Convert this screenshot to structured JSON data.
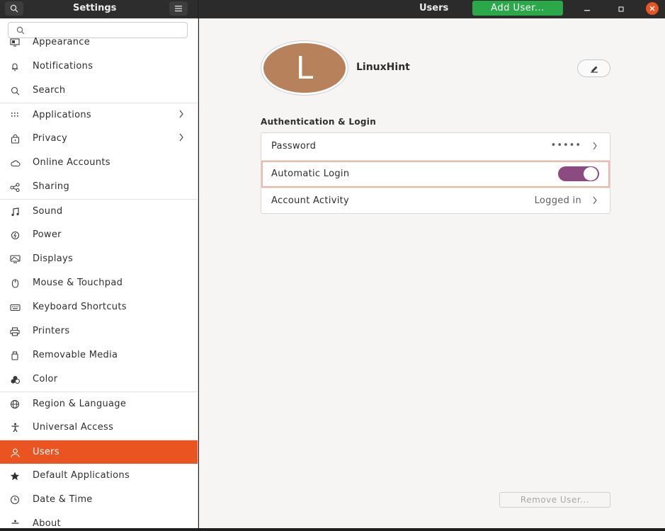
{
  "header": {
    "left_title": "Settings",
    "right_title": "Users",
    "add_user_label": "Add User..."
  },
  "sidebar": {
    "search_placeholder": "",
    "items": [
      {
        "label": "Appearance",
        "icon": "appearance-icon"
      },
      {
        "label": "Notifications",
        "icon": "bell-icon"
      },
      {
        "label": "Search",
        "icon": "search-icon"
      },
      {
        "label": "Applications",
        "icon": "grid-icon",
        "chevron": true
      },
      {
        "label": "Privacy",
        "icon": "lock-icon",
        "chevron": true
      },
      {
        "label": "Online Accounts",
        "icon": "cloud-icon"
      },
      {
        "label": "Sharing",
        "icon": "share-icon"
      },
      {
        "label": "Sound",
        "icon": "music-note-icon"
      },
      {
        "label": "Power",
        "icon": "power-icon"
      },
      {
        "label": "Displays",
        "icon": "display-icon"
      },
      {
        "label": "Mouse & Touchpad",
        "icon": "mouse-icon"
      },
      {
        "label": "Keyboard Shortcuts",
        "icon": "keyboard-icon"
      },
      {
        "label": "Printers",
        "icon": "printer-icon"
      },
      {
        "label": "Removable Media",
        "icon": "removable-media-icon"
      },
      {
        "label": "Color",
        "icon": "color-icon"
      },
      {
        "label": "Region & Language",
        "icon": "globe-icon"
      },
      {
        "label": "Universal Access",
        "icon": "accessibility-icon"
      },
      {
        "label": "Users",
        "icon": "user-icon",
        "active": true
      },
      {
        "label": "Default Applications",
        "icon": "star-icon"
      },
      {
        "label": "Date & Time",
        "icon": "clock-icon"
      },
      {
        "label": "About",
        "icon": "about-icon"
      }
    ]
  },
  "user": {
    "avatar_letter": "L",
    "name": "LinuxHint"
  },
  "auth": {
    "section_title": "Authentication & Login",
    "password_label": "Password",
    "password_value": "•••••",
    "auto_login_label": "Automatic Login",
    "auto_login_enabled": true,
    "activity_label": "Account Activity",
    "activity_value": "Logged in"
  },
  "remove_user_label": "Remove User...",
  "colors": {
    "accent": "#e95420",
    "add_user_green": "#2ba84a",
    "toggle_on": "#8c4a83",
    "avatar_bg": "#b7825b"
  }
}
